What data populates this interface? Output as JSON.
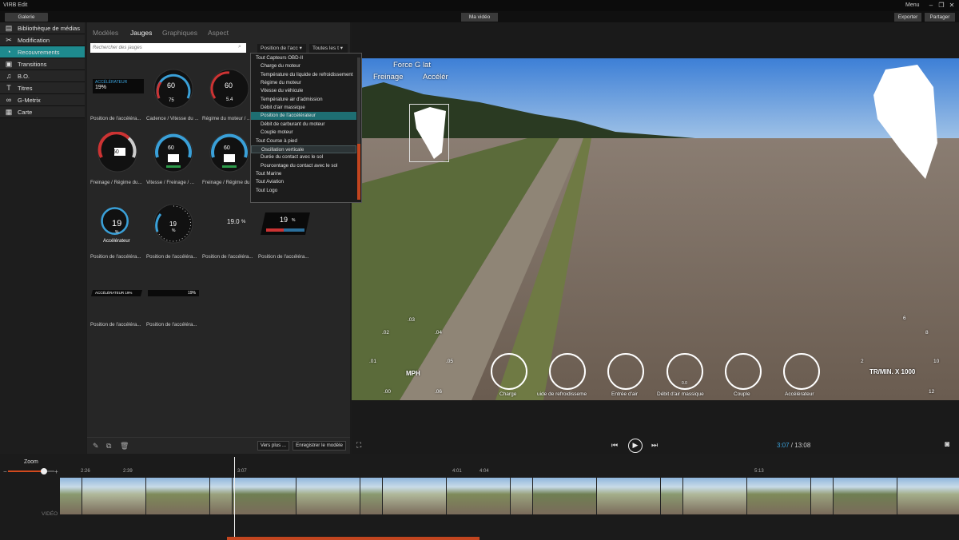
{
  "window": {
    "title": "VIRB Edit",
    "menu": "Menu"
  },
  "toolbar": {
    "gallery": "Galerie",
    "project": "Ma vidéo",
    "export": "Exporter",
    "share": "Partager"
  },
  "sidebar": {
    "items": [
      {
        "label": "Bibliothèque de médias",
        "icon": "film-icon"
      },
      {
        "label": "Modification",
        "icon": "scissors-icon"
      },
      {
        "label": "Recouvrements",
        "icon": "gauge-icon",
        "active": true
      },
      {
        "label": "Transitions",
        "icon": "transition-icon"
      },
      {
        "label": "B.O.",
        "icon": "music-icon"
      },
      {
        "label": "Titres",
        "icon": "text-icon"
      },
      {
        "label": "G-Metrix",
        "icon": "infinity-icon"
      },
      {
        "label": "Carte",
        "icon": "map-icon"
      }
    ]
  },
  "panel": {
    "tabs": [
      "Modèles",
      "Jauges",
      "Graphiques",
      "Aspect"
    ],
    "search_placeholder": "Rechercher des jauges",
    "filter1": "Position de l'acc",
    "filter2": "Toutes les t",
    "gauges": [
      {
        "label": "Position de l'accéléra...",
        "top": "ACCÉLÉRATEUR",
        "value": "19%"
      },
      {
        "label": "Cadence / Vitesse du ...",
        "value": "60",
        "sub": "75"
      },
      {
        "label": "Régime du moteur / ...",
        "value": "60",
        "sub": "5.4"
      },
      {
        "label": "Freinage / Régime du...",
        "value": "60"
      },
      {
        "label": "Vitesse / Freinage / ...",
        "value": "60"
      },
      {
        "label": "Freinage / Régime du ...",
        "value": "60"
      },
      {
        "label": "Position de l'accéléra...",
        "value": "19",
        "unit": "%",
        "caption": "Accélérateur"
      },
      {
        "label": "Position de l'accéléra...",
        "value": "19",
        "unit": "%"
      },
      {
        "label": "Position de l'accéléra...",
        "value": "19.0",
        "unit": "%"
      },
      {
        "label": "Position de l'accéléra...",
        "value": "19",
        "unit": "%"
      },
      {
        "label": "Position de l'accéléra...",
        "value": "ACCÉLÉRATEUR 19%"
      },
      {
        "label": "Position de l'accéléra...",
        "value": "19%"
      }
    ],
    "more_btn": "Vers plus ...",
    "save_btn": "Enregistrer le modèle"
  },
  "dropdown": {
    "items": [
      {
        "label": "Tout Capteurs OBD-II",
        "indent": false
      },
      {
        "label": "Charge du moteur",
        "indent": true
      },
      {
        "label": "Température du liquide de refroidissement",
        "indent": true
      },
      {
        "label": "Régime du moteur",
        "indent": true
      },
      {
        "label": "Vitesse du véhicule",
        "indent": true
      },
      {
        "label": "Température air d'admission",
        "indent": true
      },
      {
        "label": "Débit d'air massique",
        "indent": true
      },
      {
        "label": "Position de l'accélérateur",
        "indent": true,
        "highlight": true
      },
      {
        "label": "Débit de carburant du moteur",
        "indent": true
      },
      {
        "label": "Couple moteur",
        "indent": true
      },
      {
        "label": "Tout Course à pied",
        "indent": false
      },
      {
        "label": "Oscillation verticale",
        "indent": true,
        "selected": true
      },
      {
        "label": "Durée du contact avec le sol",
        "indent": true
      },
      {
        "label": "Pourcentage du contact avec le sol",
        "indent": true
      },
      {
        "label": "Tout Marine",
        "indent": false
      },
      {
        "label": "Tout Aviation",
        "indent": false
      },
      {
        "label": "Tout Logo",
        "indent": false
      }
    ]
  },
  "video_overlay": {
    "g_force_title": "Force G lat",
    "g_force_sub1": "Freinage",
    "g_force_sub2": "Accélér",
    "speed_unit": "MPH",
    "speed_ticks": [
      ".00",
      ".01",
      ".02",
      ".03",
      ".04",
      ".05",
      ".06"
    ],
    "rpm_unit": "TR/MIN. X 1000",
    "rpm_ticks": [
      "2",
      "6",
      "8",
      "10",
      "12"
    ],
    "small_gauges": [
      "Charge",
      "uide de refroidisseme",
      "Entrée d'air",
      "Débit d'air massique",
      "Couple",
      "Accélérateur"
    ],
    "mini_gauge_value": "0.0"
  },
  "player": {
    "current": "3:07",
    "separator": " / ",
    "total": "13:08"
  },
  "timeline": {
    "zoom_label": "Zoom",
    "track_label": "VIDÉO",
    "markers": [
      "2:26",
      "2:39",
      "3:07",
      "4:01",
      "4:04",
      "5:13"
    ]
  }
}
